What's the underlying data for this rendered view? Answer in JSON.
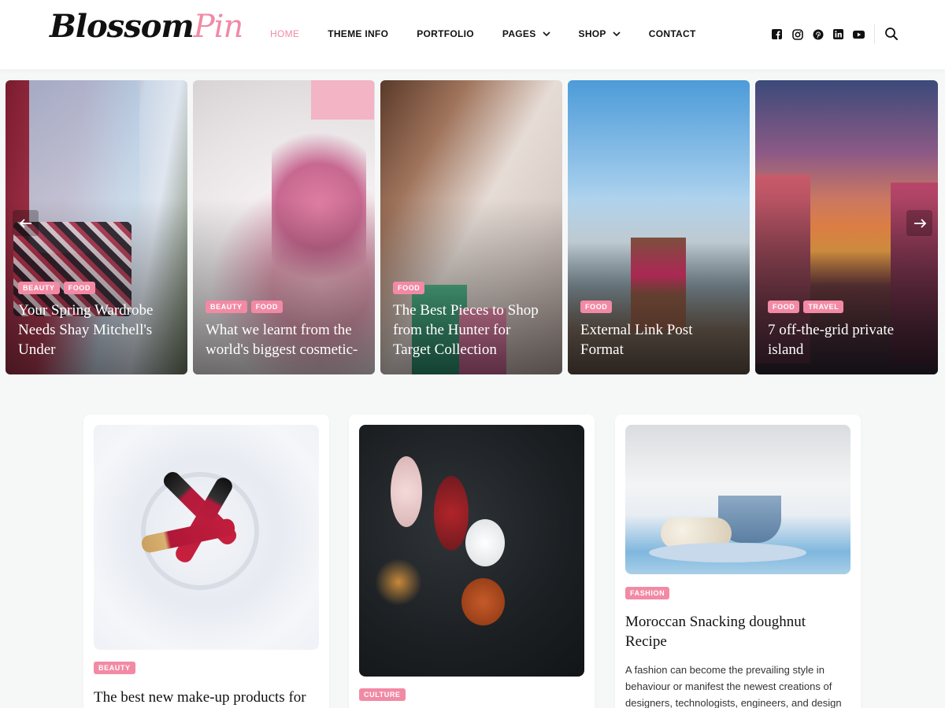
{
  "site": {
    "logo_part1": "Blossom",
    "logo_part2": "Pin"
  },
  "nav": {
    "items": [
      {
        "label": "HOME",
        "active": true
      },
      {
        "label": "THEME INFO"
      },
      {
        "label": "PORTFOLIO"
      },
      {
        "label": "PAGES",
        "dropdown": true
      },
      {
        "label": "SHOP",
        "dropdown": true
      },
      {
        "label": "CONTACT"
      }
    ]
  },
  "socials": [
    "facebook-icon",
    "instagram-icon",
    "pinterest-icon",
    "linkedin-icon",
    "youtube-icon"
  ],
  "colors": {
    "accent": "#f28aa5",
    "background": "#f6f8f8"
  },
  "slider": {
    "slides": [
      {
        "tags": [
          "BEAUTY",
          "FOOD"
        ],
        "title_lines": [
          "Your Spring Wardrobe",
          "Needs Shay Mitchell's",
          "Under"
        ]
      },
      {
        "tags": [
          "BEAUTY",
          "FOOD"
        ],
        "title_lines": [
          "What we learnt from the",
          "world's biggest cosmetic-"
        ]
      },
      {
        "tags": [
          "FOOD"
        ],
        "title_lines": [
          "The Best Pieces to Shop",
          "from the Hunter for",
          "Target Collection"
        ]
      },
      {
        "tags": [
          "FOOD"
        ],
        "title_lines": [
          "External Link Post",
          "Format"
        ]
      },
      {
        "tags": [
          "FOOD",
          "TRAVEL"
        ],
        "title_lines": [
          "7 off-the-grid private",
          "island"
        ]
      }
    ]
  },
  "posts": [
    {
      "tag": "BEAUTY",
      "title": "The best new make-up products for",
      "excerpt": ""
    },
    {
      "tag": "CULTURE",
      "title": "",
      "excerpt": ""
    },
    {
      "tag": "FASHION",
      "title_lines": [
        "Moroccan Snacking doughnut",
        "Recipe"
      ],
      "excerpt_lines": [
        "A fashion can become the prevailing style in",
        "behaviour or manifest the newest creations of",
        "designers, technologists, engineers, and design"
      ]
    }
  ]
}
